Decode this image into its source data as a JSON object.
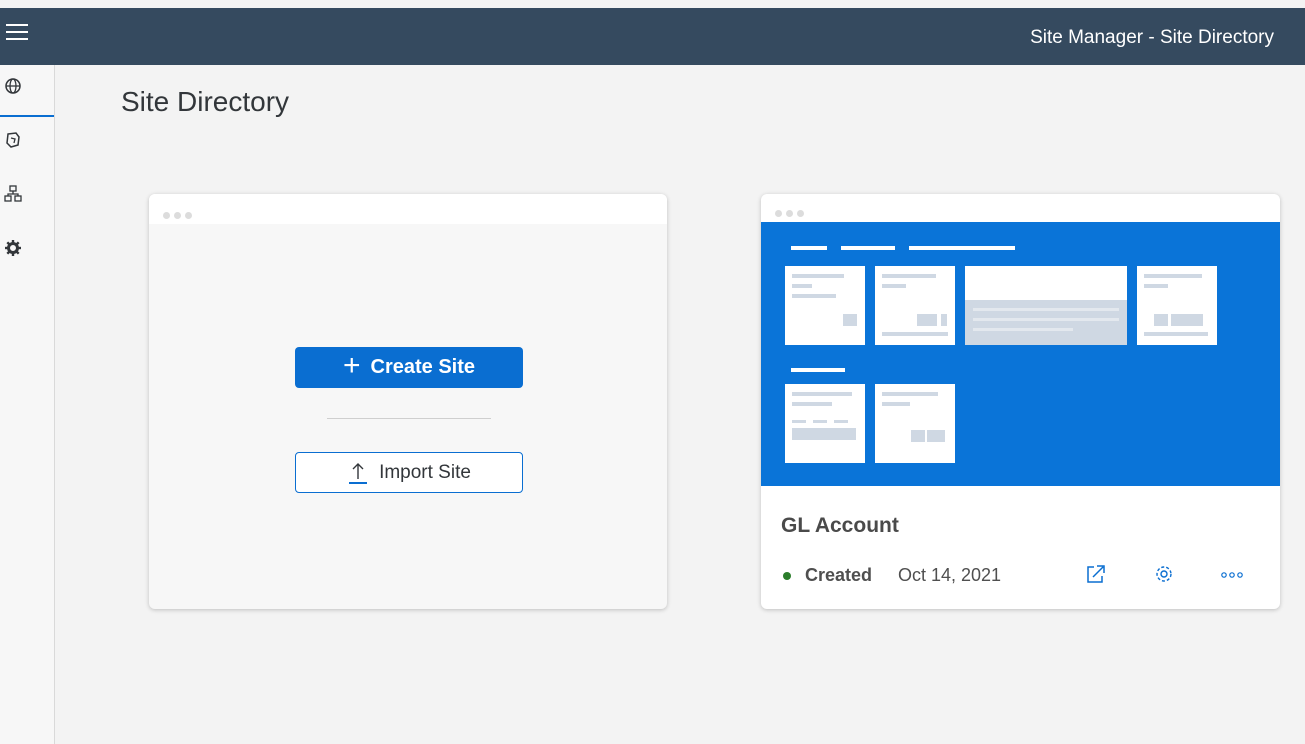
{
  "header": {
    "title": "Site Manager - Site Directory"
  },
  "sidebar": {
    "items": [
      {
        "icon": "globe-icon",
        "active": true
      },
      {
        "icon": "content-package-icon",
        "active": false
      },
      {
        "icon": "hierarchy-icon",
        "active": false
      },
      {
        "icon": "settings-icon",
        "active": false
      }
    ]
  },
  "page": {
    "title": "Site Directory"
  },
  "create_card": {
    "create_label": "Create Site",
    "import_label": "Import Site"
  },
  "site_card": {
    "name": "GL Account",
    "status": "Created",
    "date": "Oct 14, 2021",
    "status_color": "#2b7d2b",
    "actions": [
      "share-icon",
      "settings-icon",
      "more-icon"
    ]
  },
  "colors": {
    "accent": "#0a6ed1",
    "shell": "#354a5f",
    "preview": "#0a74d8"
  }
}
